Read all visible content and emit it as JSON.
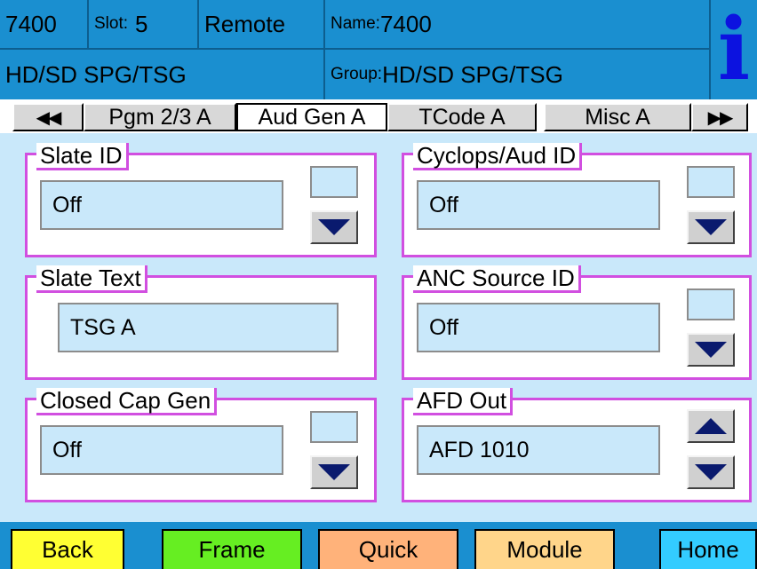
{
  "header": {
    "device": "7400",
    "slot_label": "Slot:",
    "slot_value": "5",
    "mode": "Remote",
    "name_label": "Name:",
    "name_value": "7400",
    "module_type": "HD/SD SPG/TSG",
    "group_label": "Group:",
    "group_value": "HD/SD SPG/TSG",
    "info_glyph": "i"
  },
  "tabs": {
    "prev_glyph": "◀◀",
    "next_glyph": "▶▶",
    "items": [
      "Pgm 2/3 A",
      "Aud Gen A",
      "TCode A",
      "Misc A"
    ],
    "active": "Aud Gen A"
  },
  "panels": {
    "slate_id": {
      "title": "Slate ID",
      "value": "Off"
    },
    "slate_text": {
      "title": "Slate Text",
      "value": "TSG A"
    },
    "closed_cap": {
      "title": "Closed Cap Gen",
      "value": "Off"
    },
    "cyclops": {
      "title": "Cyclops/Aud ID",
      "value": "Off"
    },
    "anc_source": {
      "title": "ANC Source ID",
      "value": "Off"
    },
    "afd_out": {
      "title": "AFD Out",
      "value": "AFD 1010"
    }
  },
  "footer": {
    "back": "Back",
    "frame": "Frame",
    "quick": "Quick",
    "module": "Module",
    "home": "Home"
  },
  "colors": {
    "header_blue": "#1a8fd0",
    "panel_bg": "#c9e8fa",
    "group_border": "#d14fe0",
    "arrow_navy": "#0a1a6e",
    "back_bg": "#ffff33",
    "frame_bg": "#66ee22",
    "quick_bg": "#ffb27a",
    "module_bg": "#ffd58a",
    "home_bg": "#33ccff"
  }
}
